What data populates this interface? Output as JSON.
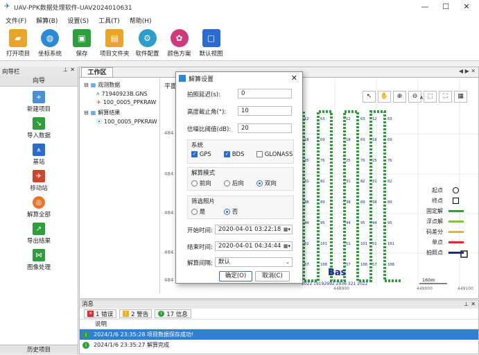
{
  "window": {
    "title": "UAV-PPK数据处理软件-UAV2024010631",
    "minimize": "—",
    "maximize": "☐",
    "close": "✕"
  },
  "menu": [
    "文件(F)",
    "解算(B)",
    "设置(S)",
    "工具(T)",
    "帮助(H)"
  ],
  "toolbar": [
    {
      "label": "打开项目",
      "icon": "folder-open-icon",
      "color": "#e8a52a"
    },
    {
      "label": "坐标系统",
      "icon": "globe-icon",
      "color": "#2a8ad6"
    },
    {
      "label": "保存",
      "icon": "save-icon",
      "color": "#2e9e3b"
    },
    {
      "label": "项目文件夹",
      "icon": "folder-icon",
      "color": "#e8a52a"
    },
    {
      "label": "软件配置",
      "icon": "settings-search-icon",
      "color": "#2a9ec9"
    },
    {
      "label": "颜色方案",
      "icon": "palette-icon",
      "color": "#d03a7a"
    },
    {
      "label": "默认视图",
      "icon": "window-icon",
      "color": "#2a6bd1"
    }
  ],
  "nav": {
    "pane_title": "向导栏",
    "header": "向导",
    "items": [
      {
        "label": "新建项目",
        "icon": "new-project-icon",
        "color": "#4a8fd6"
      },
      {
        "label": "导入数据",
        "icon": "import-icon",
        "color": "#2e9e3b"
      },
      {
        "label": "基站",
        "icon": "base-station-icon",
        "color": "#2a6bd1"
      },
      {
        "label": "移动站",
        "icon": "drone-icon",
        "color": "#d0452a"
      },
      {
        "label": "解算全部",
        "icon": "solve-all-icon",
        "color": "#e8762a"
      },
      {
        "label": "导出结果",
        "icon": "export-icon",
        "color": "#2e9e3b"
      },
      {
        "label": "图像处理",
        "icon": "image-process-icon",
        "color": "#2e9e3b"
      }
    ],
    "footer": "历史项目"
  },
  "work": {
    "tab": "工作区",
    "tree": {
      "obs": "观测数据",
      "obs_file1": "71940923B.GNS",
      "obs_file2": "100_0005_PPKRAW",
      "res": "解算结果",
      "res_file1": "100_0005_PPKRAW"
    },
    "plot_title": "平面",
    "y_ticks": [
      "484",
      "484",
      "484",
      "484",
      "484"
    ],
    "x_ticks": [
      "448900",
      "449000",
      "449100"
    ],
    "scale_label": "160m",
    "overlay_bottom": "2022 19192992 2936 321 2022"
  },
  "legend": [
    {
      "label": "起点",
      "type": "circle"
    },
    {
      "label": "终点",
      "type": "square"
    },
    {
      "label": "固定解",
      "color": "#2e9e3b"
    },
    {
      "label": "浮点解",
      "color": "#7ec832"
    },
    {
      "label": "码差分",
      "color": "#e8b22a"
    },
    {
      "label": "单点",
      "color": "#e02a2a"
    },
    {
      "label": "拍照点",
      "color": "#1a2a9a"
    }
  ],
  "dialog": {
    "title": "解算设置",
    "delay_label": "拍照延迟(s):",
    "delay": "0",
    "elev_label": "高度截止角(°):",
    "elev": "10",
    "snr_label": "信噪比阈值(dB):",
    "snr": "20",
    "sys_label": "系统",
    "sys": [
      {
        "label": "GPS",
        "checked": true
      },
      {
        "label": "BDS",
        "checked": true
      },
      {
        "label": "GLONASS",
        "checked": false
      }
    ],
    "mode_label": "解算模式",
    "modes": [
      {
        "label": "前向",
        "on": false
      },
      {
        "label": "后向",
        "on": false
      },
      {
        "label": "双向",
        "on": true
      }
    ],
    "filter_label": "筛选照片",
    "filters": [
      {
        "label": "是",
        "on": false
      },
      {
        "label": "否",
        "on": true
      }
    ],
    "start_label": "开始时间:",
    "start": "2020-04-01 03:22:18",
    "end_label": "结束时间:",
    "end": "2020-04-01 04:34:44",
    "interval_label": "解算间隔:",
    "interval": "默认",
    "ok": "确定(O)",
    "cancel": "取消(C)"
  },
  "messages": {
    "pane_title": "消息",
    "tabs": [
      {
        "label": "1 错误",
        "color": "#e02a2a"
      },
      {
        "label": "2 警告",
        "color": "#e8b22a"
      },
      {
        "label": "17 信息",
        "color": "#2e9e3b"
      }
    ],
    "column": "说明",
    "rows": [
      {
        "text": "2024/1/6 23:35:28  项目数据保存成功!"
      },
      {
        "text": "2024/1/6 23:35:27  解算完成"
      }
    ]
  }
}
